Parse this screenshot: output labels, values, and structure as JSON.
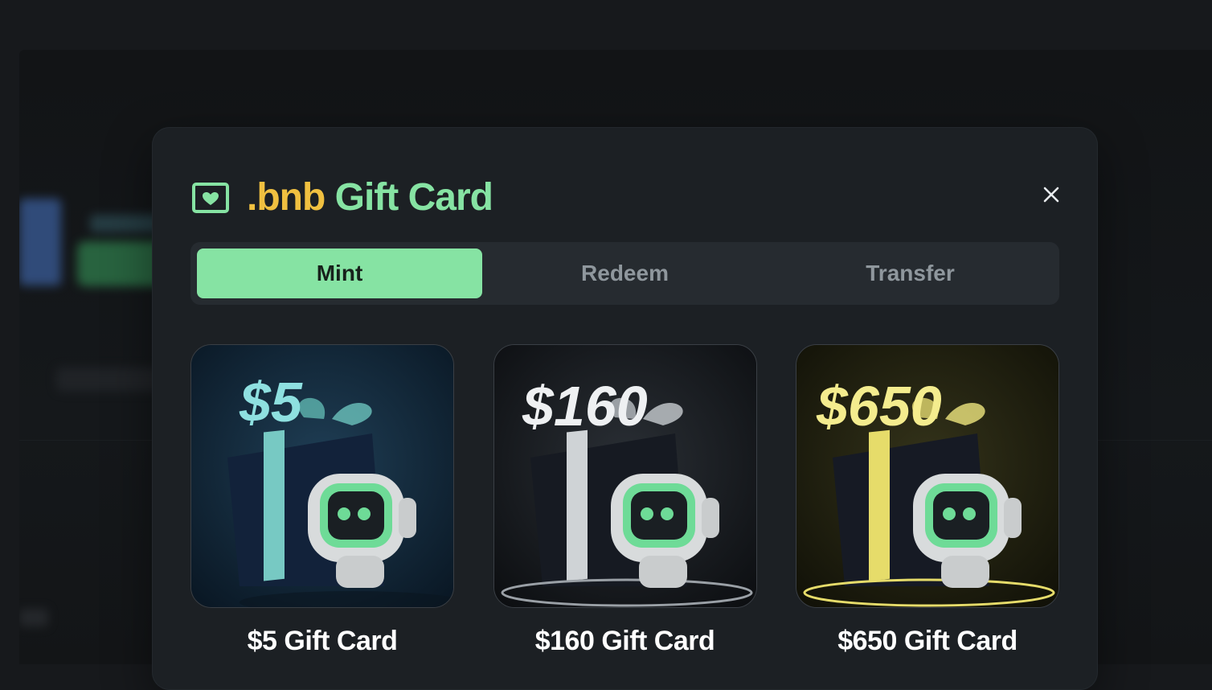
{
  "dialog": {
    "title_brand": ".bnb",
    "title_rest": " Gift Card",
    "close_label": "×"
  },
  "tabs": [
    {
      "label": "Mint",
      "active": true
    },
    {
      "label": "Redeem",
      "active": false
    },
    {
      "label": "Transfer",
      "active": false
    }
  ],
  "cards": [
    {
      "image_text": "$5",
      "label": "$5 Gift Card",
      "theme": "teal",
      "accent": "#7fd6d6",
      "bg": "#0f2232"
    },
    {
      "image_text": "$160",
      "label": "$160 Gift Card",
      "theme": "silver",
      "accent": "#e6e8ea",
      "bg": "#15181c"
    },
    {
      "image_text": "$650",
      "label": "$650 Gift Card",
      "theme": "gold",
      "accent": "#f2ea8c",
      "bg": "#1e1e0e"
    }
  ],
  "colors": {
    "accent_green": "#86e3a3",
    "brand_yellow": "#f0c040",
    "modal_bg": "#1c2024",
    "tab_track": "#262b30"
  },
  "icons": [
    "gift-card-icon",
    "close-icon"
  ]
}
